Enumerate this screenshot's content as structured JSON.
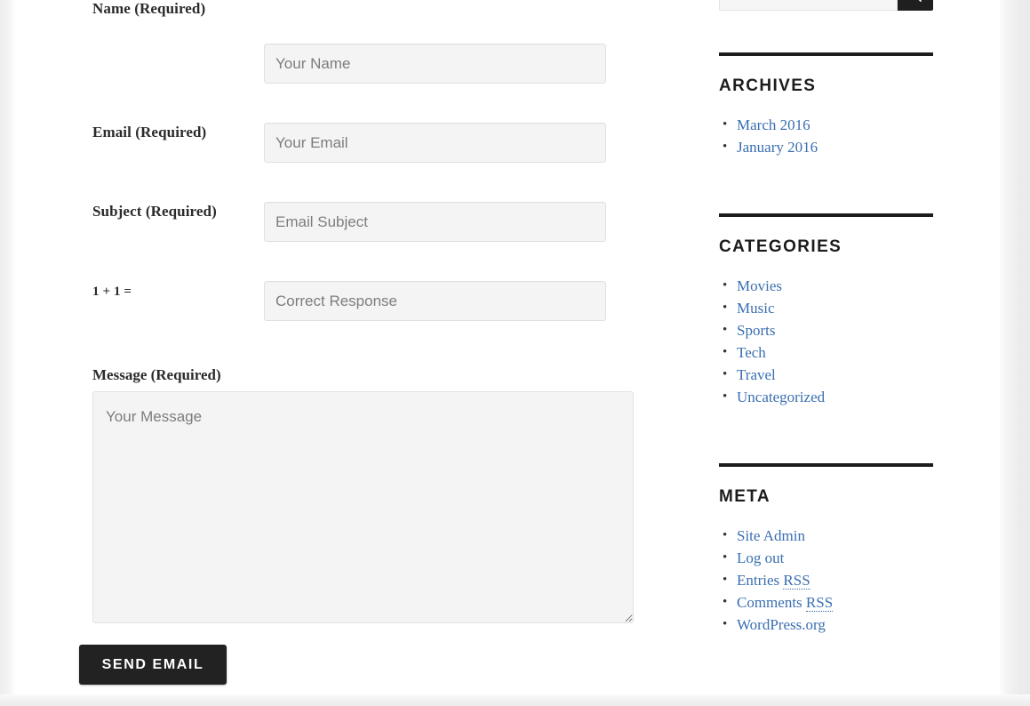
{
  "form": {
    "fields": [
      {
        "label": "Name (Required)",
        "placeholder": "Your Name",
        "value": "",
        "name": "name"
      },
      {
        "label": "Email (Required)",
        "placeholder": "Your Email",
        "value": "",
        "name": "email"
      },
      {
        "label": "Subject (Required)",
        "placeholder": "Email Subject",
        "value": "",
        "name": "subject"
      },
      {
        "label": "1 + 1 =",
        "placeholder": "Correct Response",
        "value": "",
        "name": "captcha"
      }
    ],
    "message_label": "Message (Required)",
    "message_placeholder": "Your Message",
    "message_value": "",
    "submit_label": "Send Email"
  },
  "sidebar": {
    "search": {
      "placeholder": "",
      "value": "",
      "button_icon": "search-icon"
    },
    "widgets": [
      {
        "title": "Archives",
        "items": [
          {
            "label": "March 2016"
          },
          {
            "label": "January 2016"
          }
        ]
      },
      {
        "title": "Categories",
        "items": [
          {
            "label": "Movies"
          },
          {
            "label": "Music"
          },
          {
            "label": "Sports"
          },
          {
            "label": "Tech"
          },
          {
            "label": "Travel"
          },
          {
            "label": "Uncategorized"
          }
        ]
      },
      {
        "title": "Meta",
        "items": [
          {
            "label": "Site Admin"
          },
          {
            "label": "Log out"
          },
          {
            "label": "Entries ",
            "abbr": "RSS"
          },
          {
            "label": "Comments ",
            "abbr": "RSS"
          },
          {
            "label": "WordPress.org"
          }
        ]
      }
    ]
  },
  "colors": {
    "link": "#3a6fb0",
    "accent_dark": "#1c1c1c",
    "field_bg": "#f4f4f4",
    "page_bg": "#ffffff",
    "outer_bg": "#ececec"
  }
}
